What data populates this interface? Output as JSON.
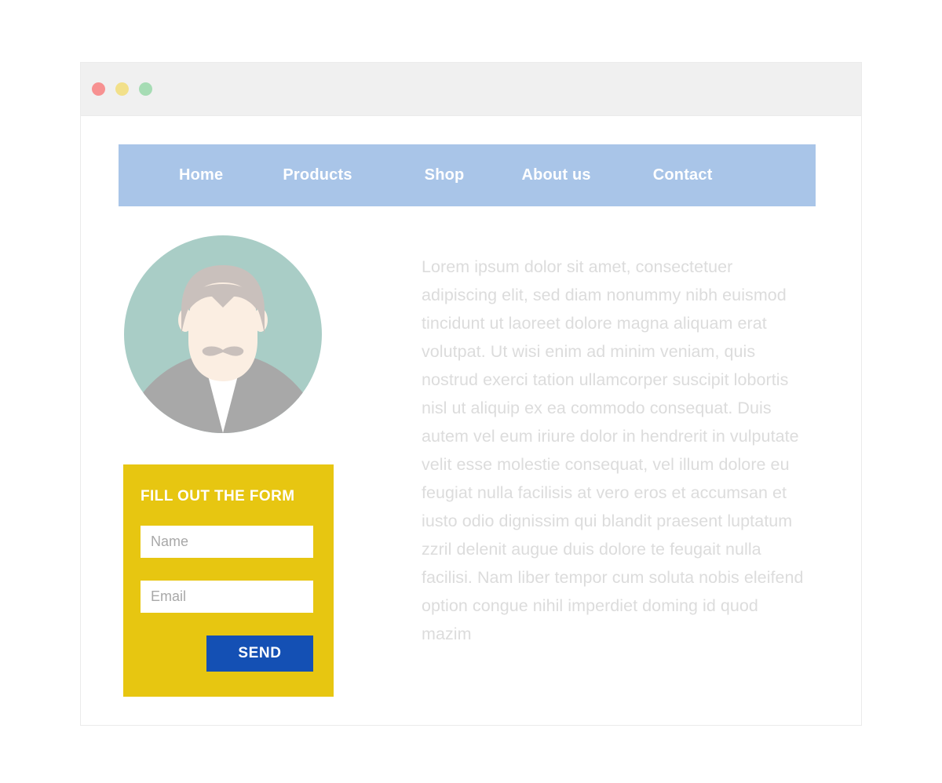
{
  "window": {
    "controls": [
      {
        "name": "close",
        "color": "#f79191"
      },
      {
        "name": "minimize",
        "color": "#f2e08a"
      },
      {
        "name": "maximize",
        "color": "#a6dcb4"
      }
    ]
  },
  "nav": {
    "background": "#a9c5e8",
    "text_color": "#ffffff",
    "items": [
      {
        "label": "Home"
      },
      {
        "label": "Products"
      },
      {
        "label": "Shop"
      },
      {
        "label": "About us"
      },
      {
        "label": "Contact"
      }
    ]
  },
  "avatar": {
    "icon": "user-avatar-icon",
    "circle_color": "#a9cdc6",
    "hair_color": "#c9c0bc",
    "skin_color": "#fbeee2",
    "shirt_color": "#ffffff",
    "suit_color": "#a8a8a8"
  },
  "form": {
    "title": "FILL OUT THE FORM",
    "background": "#e7c611",
    "fields": [
      {
        "name": "name",
        "placeholder": "Name",
        "value": ""
      },
      {
        "name": "email",
        "placeholder": "Email",
        "value": ""
      }
    ],
    "submit_label": "SEND",
    "submit_color": "#1450b4"
  },
  "content": {
    "text_color": "#dcdcdc",
    "paragraph": "Lorem ipsum dolor sit amet, consectetuer adipiscing elit, sed diam nonummy nibh euismod tincidunt ut laoreet dolore magna aliquam erat volutpat. Ut wisi enim ad minim veniam, quis nostrud exerci tation ullamcorper suscipit lobortis nisl ut aliquip ex ea commodo consequat. Duis autem vel eum iriure dolor in hendrerit in vulputate velit esse molestie consequat, vel illum dolore eu feugiat nulla facilisis at vero eros et accumsan et iusto odio dignissim qui blandit praesent luptatum zzril delenit augue duis dolore te feugait nulla facilisi. Nam liber tempor cum soluta nobis eleifend option congue nihil imperdiet doming id quod mazim"
  }
}
